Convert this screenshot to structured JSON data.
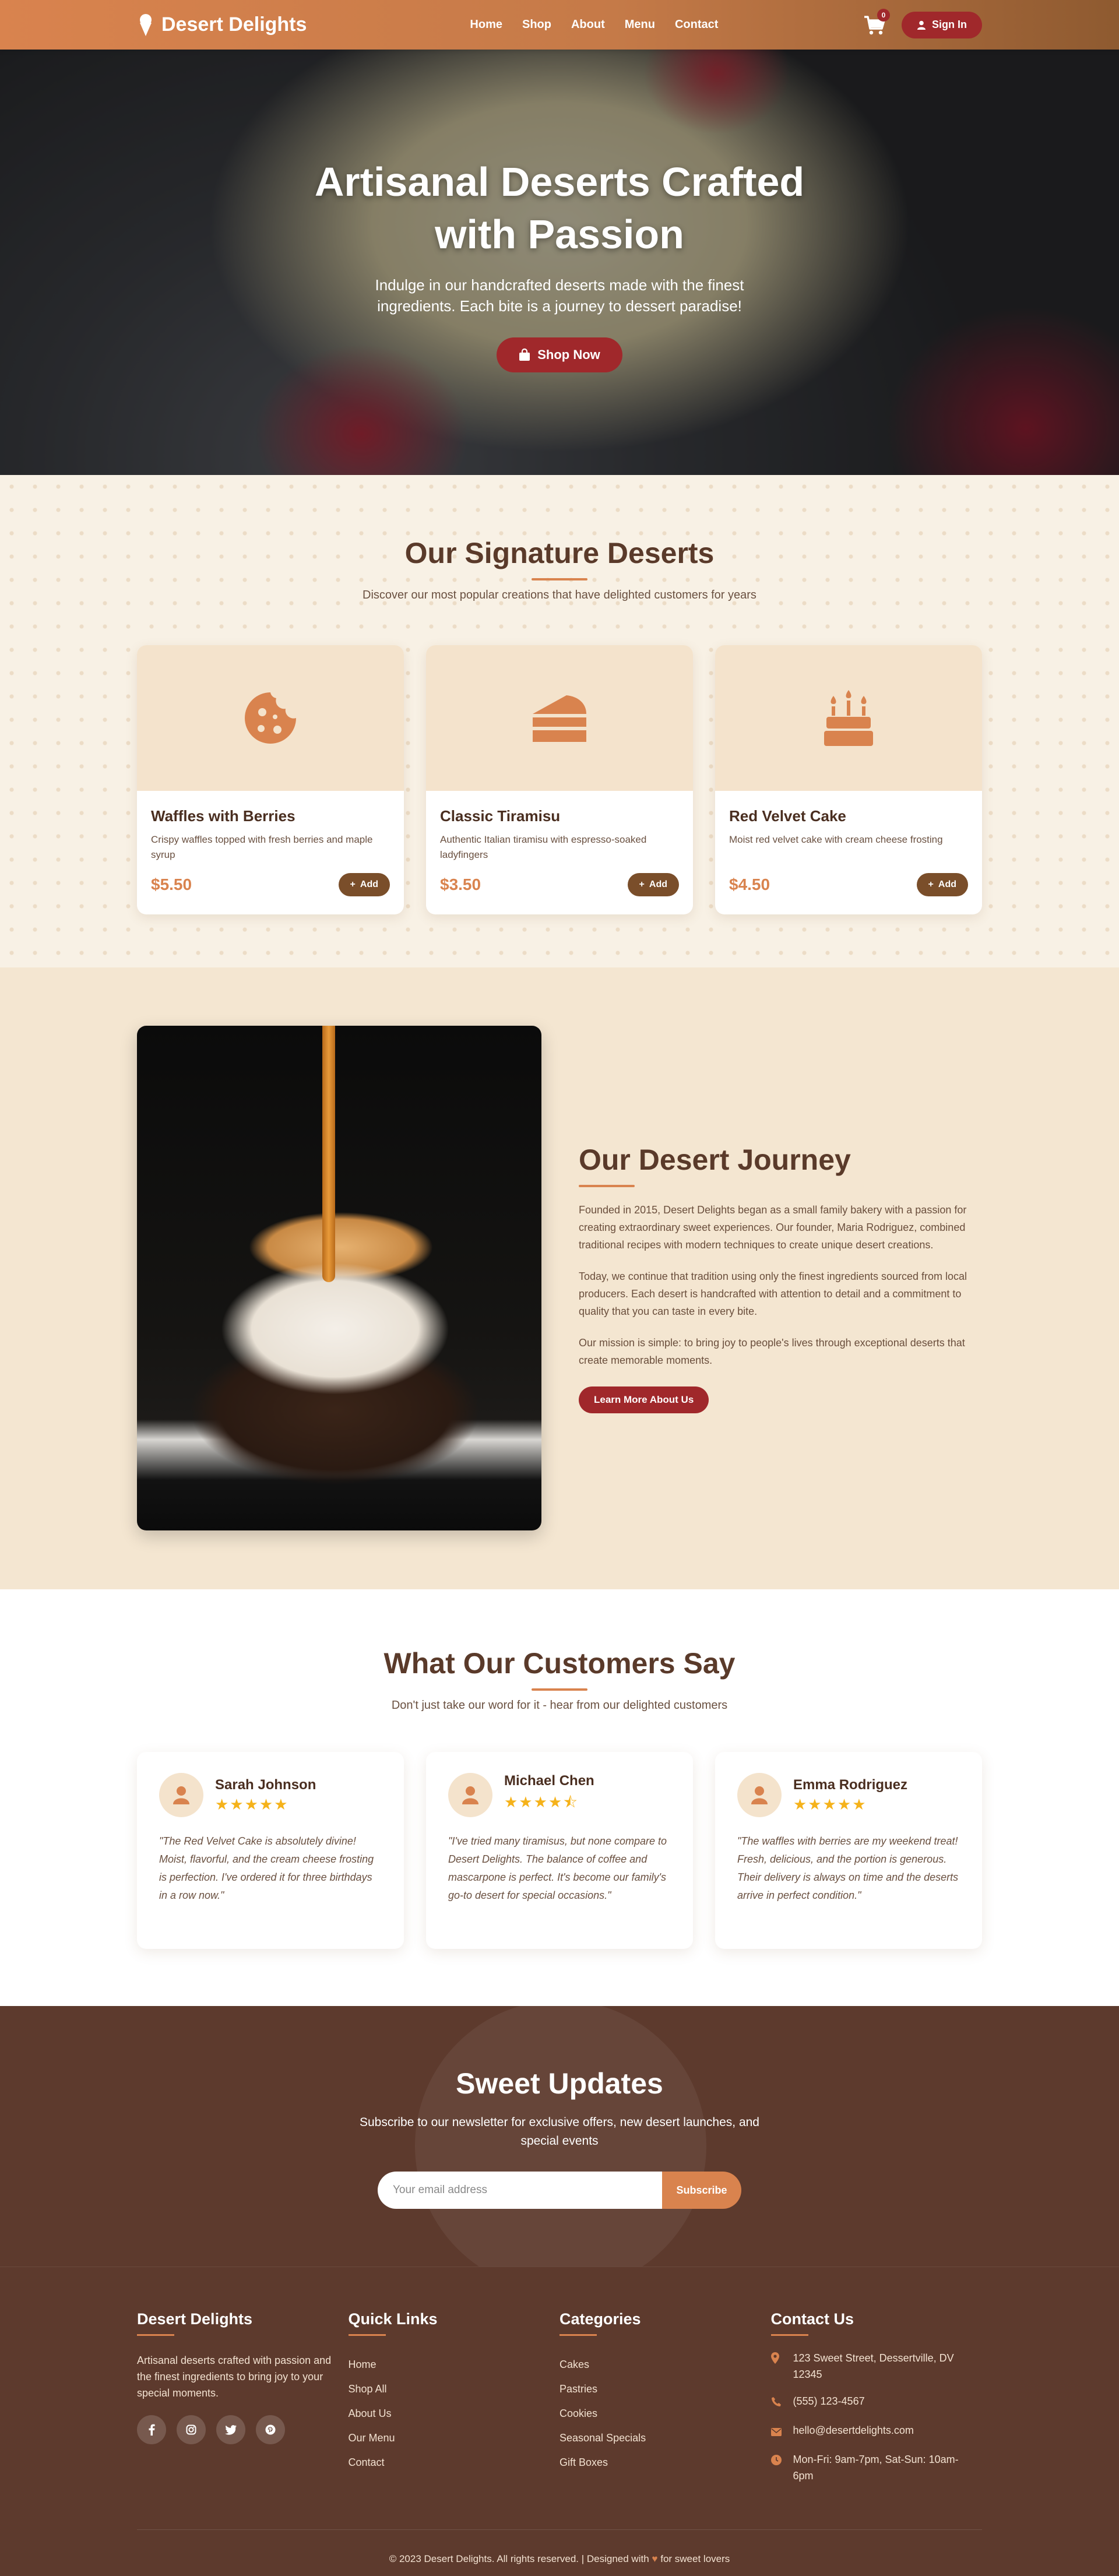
{
  "nav": {
    "brand": "Desert Delights",
    "links": [
      "Home",
      "Shop",
      "About",
      "Menu",
      "Contact"
    ],
    "cart_count": "0",
    "signin_label": "Sign In"
  },
  "hero": {
    "title": "Artisanal Deserts Crafted with Passion",
    "subtitle": "Indulge in our handcrafted deserts made with the finest ingredients. Each bite is a journey to dessert paradise!",
    "cta": "Shop Now"
  },
  "signature": {
    "title": "Our Signature Deserts",
    "subtitle": "Discover our most popular creations that have delighted customers for years",
    "add_label": "Add",
    "items": [
      {
        "name": "Waffles with Berries",
        "desc": "Crispy waffles topped with fresh berries and maple syrup",
        "price": "$5.50",
        "icon": "cookie-icon"
      },
      {
        "name": "Classic Tiramisu",
        "desc": "Authentic Italian tiramisu with espresso-soaked ladyfingers",
        "price": "$3.50",
        "icon": "cake-slice-icon"
      },
      {
        "name": "Red Velvet Cake",
        "desc": "Moist red velvet cake with cream cheese frosting",
        "price": "$4.50",
        "icon": "birthday-cake-icon"
      }
    ]
  },
  "journey": {
    "title": "Our Desert Journey",
    "paragraphs": [
      "Founded in 2015, Desert Delights began as a small family bakery with a passion for creating extraordinary sweet experiences. Our founder, Maria Rodriguez, combined traditional recipes with modern techniques to create unique desert creations.",
      "Today, we continue that tradition using only the finest ingredients sourced from local producers. Each desert is handcrafted with attention to detail and a commitment to quality that you can taste in every bite.",
      "Our mission is simple: to bring joy to people's lives through exceptional deserts that create memorable moments."
    ],
    "cta": "Learn More About Us"
  },
  "testimonials": {
    "title": "What Our Customers Say",
    "subtitle": "Don't just take our word for it - hear from our delighted customers",
    "items": [
      {
        "name": "Sarah Johnson",
        "stars": "★★★★★",
        "rating": 5,
        "quote": "\"The Red Velvet Cake is absolutely divine! Moist, flavorful, and the cream cheese frosting is perfection. I've ordered it for three birthdays in a row now.\""
      },
      {
        "name": "Michael Chen",
        "stars": "★★★★⯪",
        "rating": 4.5,
        "quote": "\"I've tried many tiramisus, but none compare to Desert Delights. The balance of coffee and mascarpone is perfect. It's become our family's go-to desert for special occasions.\""
      },
      {
        "name": "Emma Rodriguez",
        "stars": "★★★★★",
        "rating": 5,
        "quote": "\"The waffles with berries are my weekend treat! Fresh, delicious, and the portion is generous. Their delivery is always on time and the deserts arrive in perfect condition.\""
      }
    ]
  },
  "newsletter": {
    "title": "Sweet Updates",
    "subtitle": "Subscribe to our newsletter for exclusive offers, new desert launches, and special events",
    "placeholder": "Your email address",
    "button": "Subscribe"
  },
  "footer": {
    "brand": "Desert Delights",
    "about": "Artisanal deserts crafted with passion and the finest ingredients to bring joy to your special moments.",
    "social": [
      "facebook-icon",
      "instagram-icon",
      "twitter-icon",
      "pinterest-icon"
    ],
    "quick_links_title": "Quick Links",
    "quick_links": [
      "Home",
      "Shop All",
      "About Us",
      "Our Menu",
      "Contact"
    ],
    "categories_title": "Categories",
    "categories": [
      "Cakes",
      "Pastries",
      "Cookies",
      "Seasonal Specials",
      "Gift Boxes"
    ],
    "contact_title": "Contact Us",
    "address": "123 Sweet Street, Dessertville, DV 12345",
    "phone": "(555) 123-4567",
    "email": "hello@desertdelights.com",
    "hours": "Mon-Fri: 9am-7pm, Sat-Sun: 10am-6pm",
    "copyright_pre": "© 2023 Desert Delights. All rights reserved. | Designed with",
    "copyright_post": "for sweet lovers"
  },
  "colors": {
    "accent": "#d9834e",
    "brand_dark": "#5d3a2d",
    "button_red": "#a0282b",
    "star": "#f5b21a"
  }
}
